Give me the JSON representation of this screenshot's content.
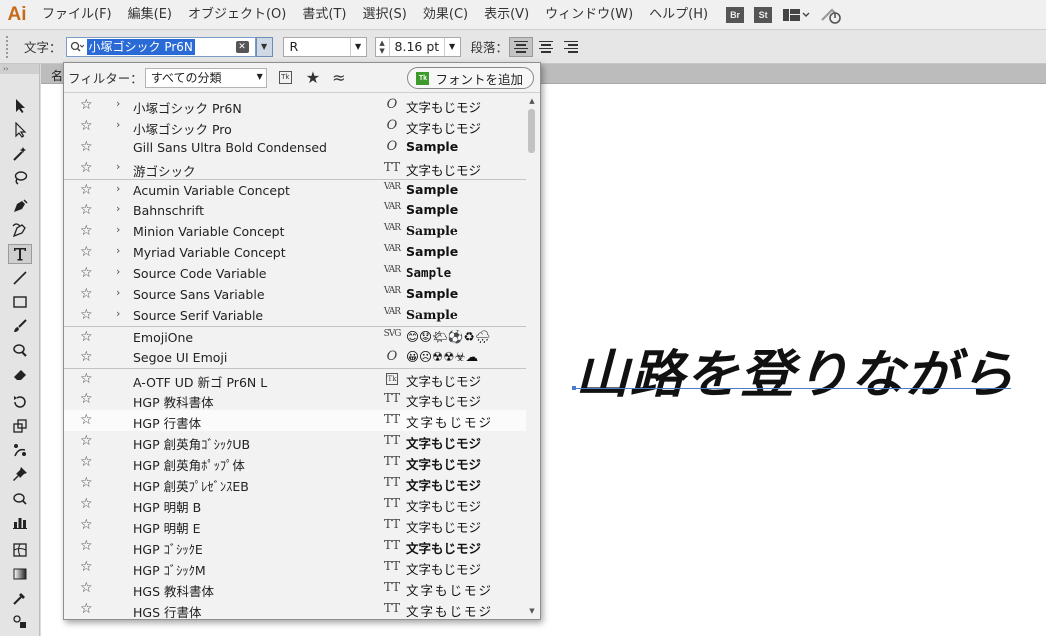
{
  "app": {
    "logo": "Ai"
  },
  "menu": {
    "items": [
      "ファイル(F)",
      "編集(E)",
      "オブジェクト(O)",
      "書式(T)",
      "選択(S)",
      "効果(C)",
      "表示(V)",
      "ウィンドウ(W)",
      "ヘルプ(H)"
    ],
    "bridge_badge": "Br",
    "stock_badge": "St",
    "workspace_icon": "workspace-layout-icon",
    "sync_icon": "gpu-performance-icon"
  },
  "control": {
    "char_label": "文字：",
    "font_value": "小塚ゴシック Pr6N",
    "style_value": "R",
    "size_value": "8.16 pt",
    "para_label": "段落："
  },
  "document": {
    "tab_label": "名",
    "artwork_text": "山路を登りながら"
  },
  "font_menu": {
    "filter_label": "フィルター：",
    "filter_value": "すべての分類",
    "typekit_icon": "Tk",
    "add_font_label": "フォントを追加",
    "fonts": [
      {
        "name": "小塚ゴシック Pr6N",
        "expand": "›",
        "type": "O",
        "sample": "文字もじモジ"
      },
      {
        "name": "小塚ゴシック Pro",
        "expand": "›",
        "type": "O",
        "sample": "文字もじモジ"
      },
      {
        "name": "Gill Sans Ultra Bold Condensed",
        "expand": "",
        "type": "O",
        "sample": "Sample"
      },
      {
        "name": "游ゴシック",
        "expand": "›",
        "type": "TT",
        "sample": "文字もじモジ"
      },
      {
        "name": "Acumin Variable Concept",
        "expand": "›",
        "type": "VAR",
        "sample": "Sample"
      },
      {
        "name": "Bahnschrift",
        "expand": "›",
        "type": "VAR",
        "sample": "Sample"
      },
      {
        "name": "Minion Variable Concept",
        "expand": "›",
        "type": "VAR",
        "sample": "Sample"
      },
      {
        "name": "Myriad Variable Concept",
        "expand": "›",
        "type": "VAR",
        "sample": "Sample"
      },
      {
        "name": "Source Code Variable",
        "expand": "›",
        "type": "VAR",
        "sample": "Sample"
      },
      {
        "name": "Source Sans Variable",
        "expand": "›",
        "type": "VAR",
        "sample": "Sample"
      },
      {
        "name": "Source Serif Variable",
        "expand": "›",
        "type": "VAR",
        "sample": "Sample"
      },
      {
        "name": "EmojiOne",
        "expand": "",
        "type": "SVG",
        "sample": "😊😟🌤⚽♻🌧"
      },
      {
        "name": "Segoe UI Emoji",
        "expand": "",
        "type": "O",
        "sample": "😀☹☢☢☣☁"
      },
      {
        "name": "A-OTF UD 新ゴ Pr6N L",
        "expand": "",
        "type": "Tk",
        "sample": "文字もじモジ"
      },
      {
        "name": "HGP 教科書体",
        "expand": "",
        "type": "TT",
        "sample": "文字もじモジ"
      },
      {
        "name": "HGP 行書体",
        "expand": "",
        "type": "TT",
        "sample": "文字もじモジ"
      },
      {
        "name": "HGP 創英角ｺﾞｼｯｸUB",
        "expand": "",
        "type": "TT",
        "sample": "文字もじモジ"
      },
      {
        "name": "HGP 創英角ﾎﾟｯﾌﾟ体",
        "expand": "",
        "type": "TT",
        "sample": "文字もじモジ"
      },
      {
        "name": "HGP 創英ﾌﾟﾚｾﾞﾝｽEB",
        "expand": "",
        "type": "TT",
        "sample": "文字もじモジ"
      },
      {
        "name": "HGP 明朝 B",
        "expand": "",
        "type": "TT",
        "sample": "文字もじモジ"
      },
      {
        "name": "HGP 明朝 E",
        "expand": "",
        "type": "TT",
        "sample": "文字もじモジ"
      },
      {
        "name": "HGP ｺﾞｼｯｸE",
        "expand": "",
        "type": "TT",
        "sample": "文字もじモジ"
      },
      {
        "name": "HGP ｺﾞｼｯｸM",
        "expand": "",
        "type": "TT",
        "sample": "文字もじモジ"
      },
      {
        "name": "HGS 教科書体",
        "expand": "",
        "type": "TT",
        "sample": "文字もじモジ"
      },
      {
        "name": "HGS 行書体",
        "expand": "",
        "type": "TT",
        "sample": "文字もじモジ"
      }
    ]
  }
}
